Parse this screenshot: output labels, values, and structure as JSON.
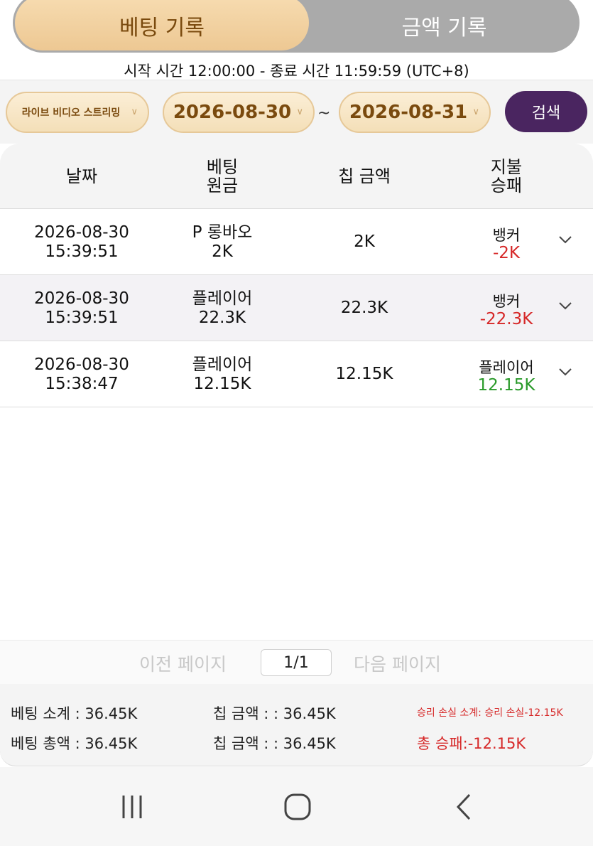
{
  "tabs": [
    {
      "label": "베팅 기록",
      "active": true
    },
    {
      "label": "금액 기록",
      "active": false
    }
  ],
  "time_range_text": "시작 시간 12:00:00 - 종료 시간 11:59:59 (UTC+8)",
  "filters": {
    "stream_select": "라이브 비디오 스트리밍",
    "date_from": "2026-08-30",
    "date_separator": "~",
    "date_to": "2026-08-31",
    "search_label": "검색"
  },
  "table": {
    "headers": {
      "date": "날짜",
      "bet_line1": "베팅",
      "bet_line2": "원금",
      "chip": "칩 금액",
      "pay_line1": "지불",
      "pay_line2": "승패"
    },
    "rows": [
      {
        "date": "2026-08-30",
        "time": "15:39:51",
        "bet_type": "P 롱바오",
        "bet_amount": "2K",
        "chip": "2K",
        "result": "뱅커",
        "winloss": "-2K",
        "winloss_sign": "neg"
      },
      {
        "date": "2026-08-30",
        "time": "15:39:51",
        "bet_type": "플레이어",
        "bet_amount": "22.3K",
        "chip": "22.3K",
        "result": "뱅커",
        "winloss": "-22.3K",
        "winloss_sign": "neg"
      },
      {
        "date": "2026-08-30",
        "time": "15:38:47",
        "bet_type": "플레이어",
        "bet_amount": "12.15K",
        "chip": "12.15K",
        "result": "플레이어",
        "winloss": "12.15K",
        "winloss_sign": "pos"
      }
    ]
  },
  "pagination": {
    "prev_label": "이전 페이지",
    "page_indicator": "1/1",
    "next_label": "다음 페이지"
  },
  "summary": {
    "bet_subtotal": "베팅 소계 : 36.45K",
    "chip_subtotal": "칩 금액 : : 36.45K",
    "winloss_subtotal": "승리 손실 소계: 승리 손실-12.15K",
    "bet_total": "베팅 총액 : 36.45K",
    "chip_total": "칩 금액 : : 36.45K",
    "winloss_total": "총 승패:-12.15K"
  },
  "colors": {
    "tab_active": "#edc893",
    "tab_inactive": "#aaaaaa",
    "search_button": "#4a2560",
    "negative": "#d62828",
    "positive": "#2a9a2a"
  },
  "navbar": {
    "recent_icon": "recent-apps-icon",
    "home_icon": "home-icon",
    "back_icon": "back-icon"
  }
}
